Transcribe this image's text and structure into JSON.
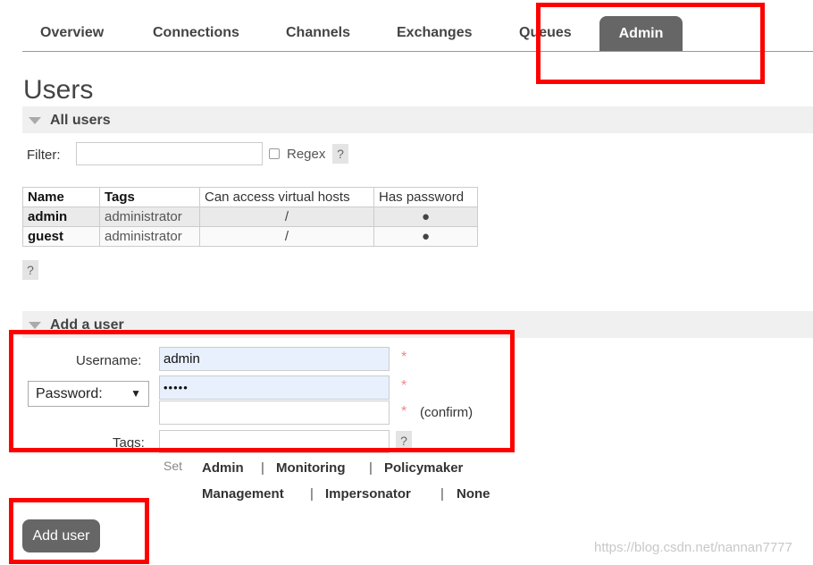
{
  "nav": {
    "tabs": [
      "Overview",
      "Connections",
      "Channels",
      "Exchanges",
      "Queues",
      "Admin"
    ],
    "active": "Admin"
  },
  "page": {
    "title": "Users"
  },
  "all_users": {
    "heading": "All users",
    "filter_label": "Filter:",
    "filter_value": "",
    "regex_label": "Regex",
    "help": "?",
    "columns": [
      "Name",
      "Tags",
      "Can access virtual hosts",
      "Has password"
    ],
    "rows": [
      {
        "name": "admin",
        "tags": "administrator",
        "vhosts": "/",
        "has_password": "●"
      },
      {
        "name": "guest",
        "tags": "administrator",
        "vhosts": "/",
        "has_password": "●"
      }
    ],
    "table_help": "?"
  },
  "add_user": {
    "heading": "Add a user",
    "username_label": "Username:",
    "username_value": "admin",
    "password_select": "Password:",
    "password_value": "•••••",
    "confirm_value": "",
    "required": "*",
    "confirm_label": "(confirm)",
    "tags_label": "Tags:",
    "tags_value": "",
    "tags_help": "?",
    "set_label": "Set",
    "tag_options": [
      "Admin",
      "Monitoring",
      "Policymaker",
      "Management",
      "Impersonator",
      "None"
    ],
    "separator": "|",
    "submit_label": "Add user"
  },
  "watermark": "https://blog.csdn.net/nannan7777",
  "colors": {
    "tab_active_bg": "#666666",
    "highlight": "#ff0000",
    "autofill_bg": "#e8f0fe"
  }
}
